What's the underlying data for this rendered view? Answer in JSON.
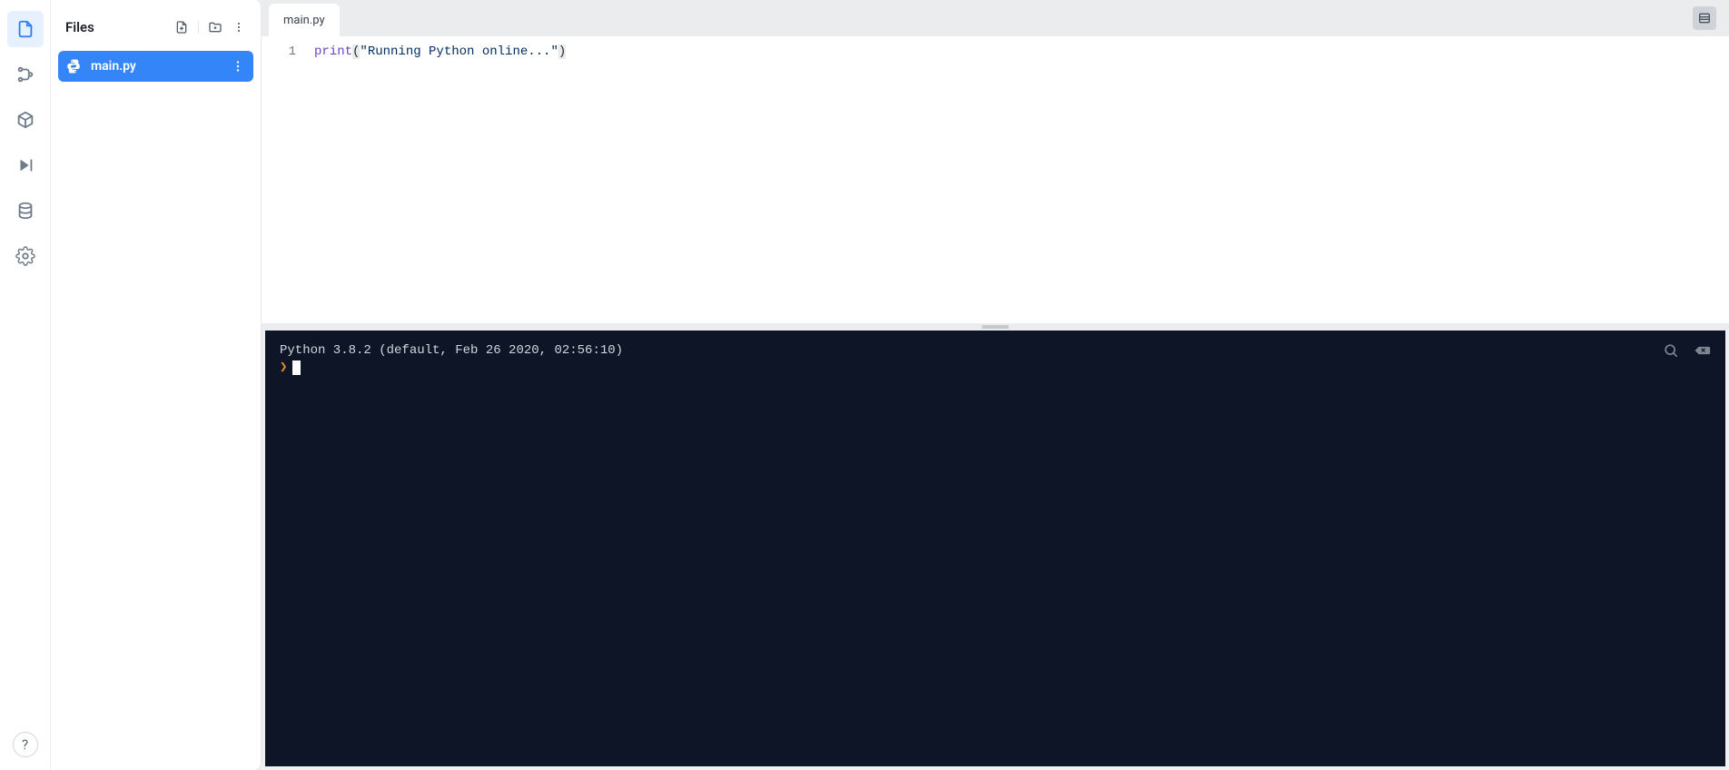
{
  "rail": {
    "help": "?"
  },
  "filesPanel": {
    "title": "Files",
    "items": [
      {
        "label": "main.py"
      }
    ]
  },
  "tabs": [
    {
      "label": "main.py"
    }
  ],
  "code": {
    "lines": [
      {
        "num": "1",
        "fn": "print",
        "openParen": "(",
        "str": "\"Running Python online...\"",
        "closeParen": ")"
      }
    ]
  },
  "console": {
    "versionLine": "Python 3.8.2 (default, Feb 26 2020, 02:56:10)",
    "promptSymbol": "❯"
  }
}
